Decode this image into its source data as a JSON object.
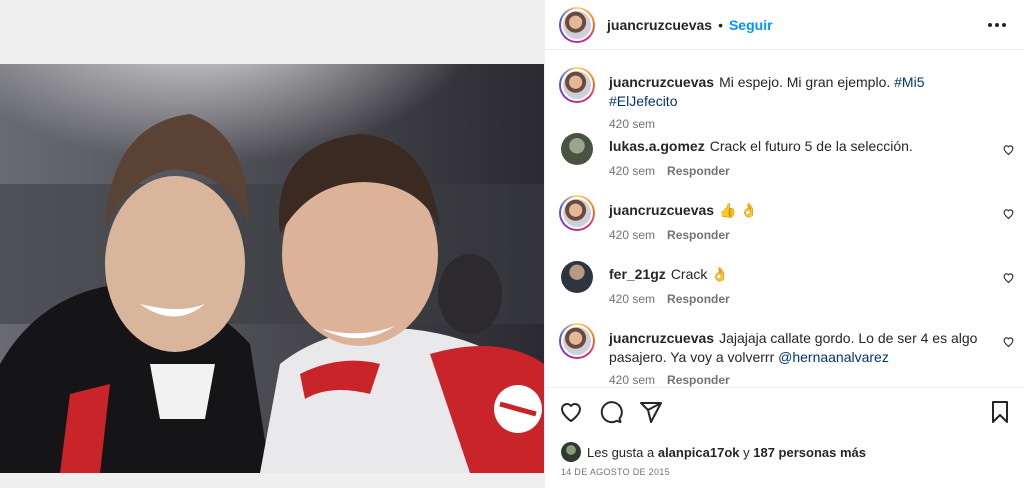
{
  "post": {
    "author": "juancruzcuevas",
    "follow_label": "Seguir",
    "separator": "•",
    "caption": "Mi espejo. Mi gran ejemplo.",
    "caption_tags": "#Mi5 #ElJefecito",
    "caption_age": "420 sem"
  },
  "comments": [
    {
      "user": "lukas.a.gomez",
      "text": "Crack el futuro 5 de la selección.",
      "age": "420 sem",
      "reply": "Responder"
    },
    {
      "user": "juancruzcuevas",
      "text": "👍 👌",
      "age": "420 sem",
      "reply": "Responder"
    },
    {
      "user": "fer_21gz",
      "text": "Crack 👌",
      "age": "420 sem",
      "reply": "Responder"
    },
    {
      "user": "juancruzcuevas",
      "text": "Jajajaja callate gordo. Lo de ser 4 es algo pasajero. Ya voy a volverrr",
      "mention": "@hernaanalvarez",
      "age": "420 sem",
      "reply": "Responder"
    }
  ],
  "likes": {
    "prefix": "Les gusta a",
    "user": "alanpica17ok",
    "middle": "y",
    "others": "187 personas más"
  },
  "date": "14 DE AGOSTO DE 2015",
  "icons": {
    "like": "heart-icon",
    "comment": "comment-icon",
    "share": "share-icon",
    "save": "bookmark-icon",
    "more": "more-options-icon"
  },
  "colors": {
    "accent": "#0095f6",
    "tag": "#00376b",
    "muted": "#737373"
  }
}
